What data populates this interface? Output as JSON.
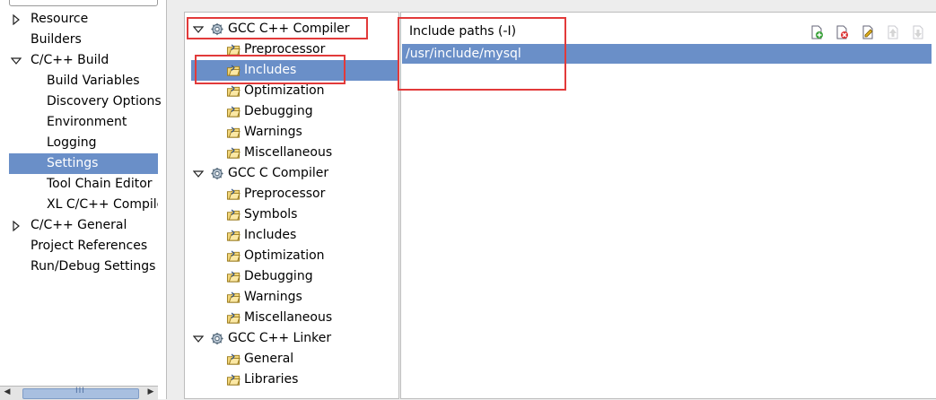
{
  "nav": {
    "items": [
      {
        "label": "Resource"
      },
      {
        "label": "Builders"
      },
      {
        "label": "C/C++ Build"
      },
      {
        "label": "Build Variables"
      },
      {
        "label": "Discovery Options"
      },
      {
        "label": "Environment"
      },
      {
        "label": "Logging"
      },
      {
        "label": "Settings"
      },
      {
        "label": "Tool Chain Editor"
      },
      {
        "label": "XL C/C++ Compiler"
      },
      {
        "label": "C/C++ General"
      },
      {
        "label": "Project References"
      },
      {
        "label": "Run/Debug Settings"
      }
    ],
    "selected": "Settings",
    "scrollbar_grip": "III"
  },
  "tools": {
    "items": [
      {
        "label": "GCC C++ Compiler"
      },
      {
        "label": "Preprocessor"
      },
      {
        "label": "Includes"
      },
      {
        "label": "Optimization"
      },
      {
        "label": "Debugging"
      },
      {
        "label": "Warnings"
      },
      {
        "label": "Miscellaneous"
      },
      {
        "label": "GCC C Compiler"
      },
      {
        "label": "Preprocessor"
      },
      {
        "label": "Symbols"
      },
      {
        "label": "Includes"
      },
      {
        "label": "Optimization"
      },
      {
        "label": "Debugging"
      },
      {
        "label": "Warnings"
      },
      {
        "label": "Miscellaneous"
      },
      {
        "label": "GCC C++ Linker"
      },
      {
        "label": "General"
      },
      {
        "label": "Libraries"
      }
    ],
    "selected_index": 2
  },
  "include_paths": {
    "title": "Include paths (-I)",
    "paths": [
      "/usr/include/mysql"
    ],
    "toolbar_icons": [
      "add-icon",
      "delete-icon",
      "edit-icon",
      "move-up-icon",
      "move-down-icon"
    ]
  },
  "colors": {
    "selection": "#6a8fc8",
    "highlight_box": "#e23a3a"
  }
}
